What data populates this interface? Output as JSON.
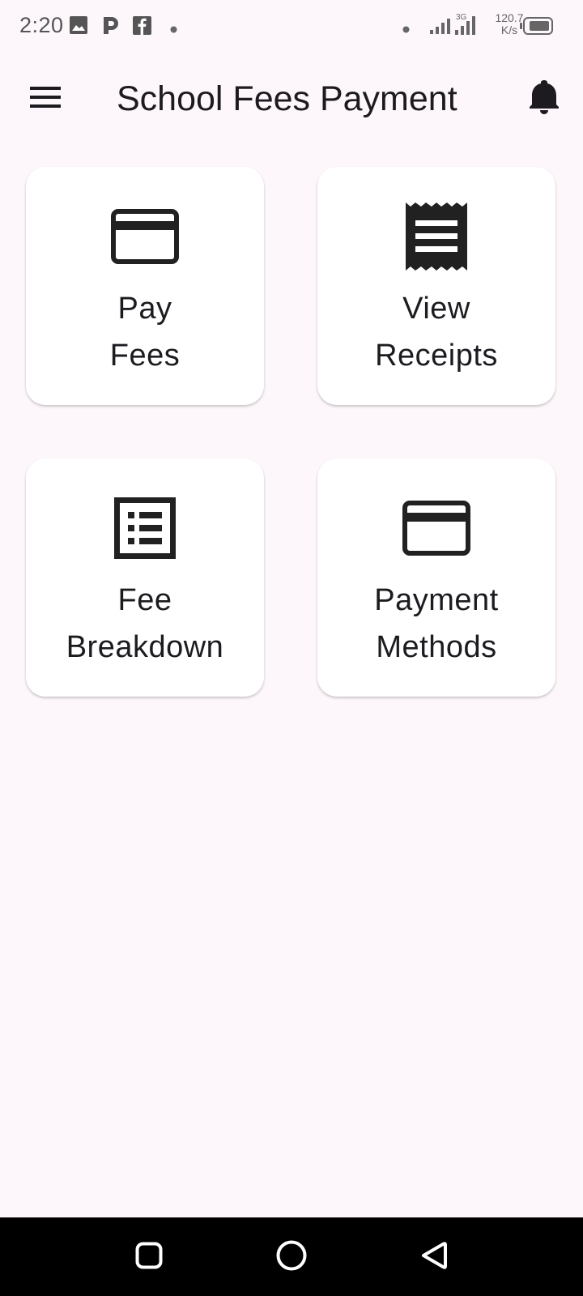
{
  "status_bar": {
    "time": "2:20",
    "net_speed_value": "120.7",
    "net_speed_unit": "K/s",
    "icons": [
      "gallery-icon",
      "parking-app-icon",
      "facebook-icon",
      "notification-dot-icon",
      "dot-icon",
      "signal-icon",
      "signal-3g-icon",
      "battery-icon"
    ]
  },
  "app_bar": {
    "title": "School Fees Payment",
    "menu_icon": "menu-icon",
    "notification_icon": "bell-icon"
  },
  "cards": [
    {
      "line1": "Pay",
      "line2": "Fees",
      "icon": "credit-card-icon"
    },
    {
      "line1": "View",
      "line2": "Receipts",
      "icon": "receipt-icon"
    },
    {
      "line1": "Fee",
      "line2": "Breakdown",
      "icon": "list-icon"
    },
    {
      "line1": "Payment",
      "line2": "Methods",
      "icon": "credit-card-icon"
    }
  ],
  "nav_bar": {
    "icons": [
      "recents-square-icon",
      "home-circle-icon",
      "back-triangle-icon"
    ]
  },
  "colors": {
    "background": "#fdf7fb",
    "card": "#ffffff",
    "text": "#1d1b20",
    "icon": "#212121",
    "nav_bar": "#000000"
  }
}
